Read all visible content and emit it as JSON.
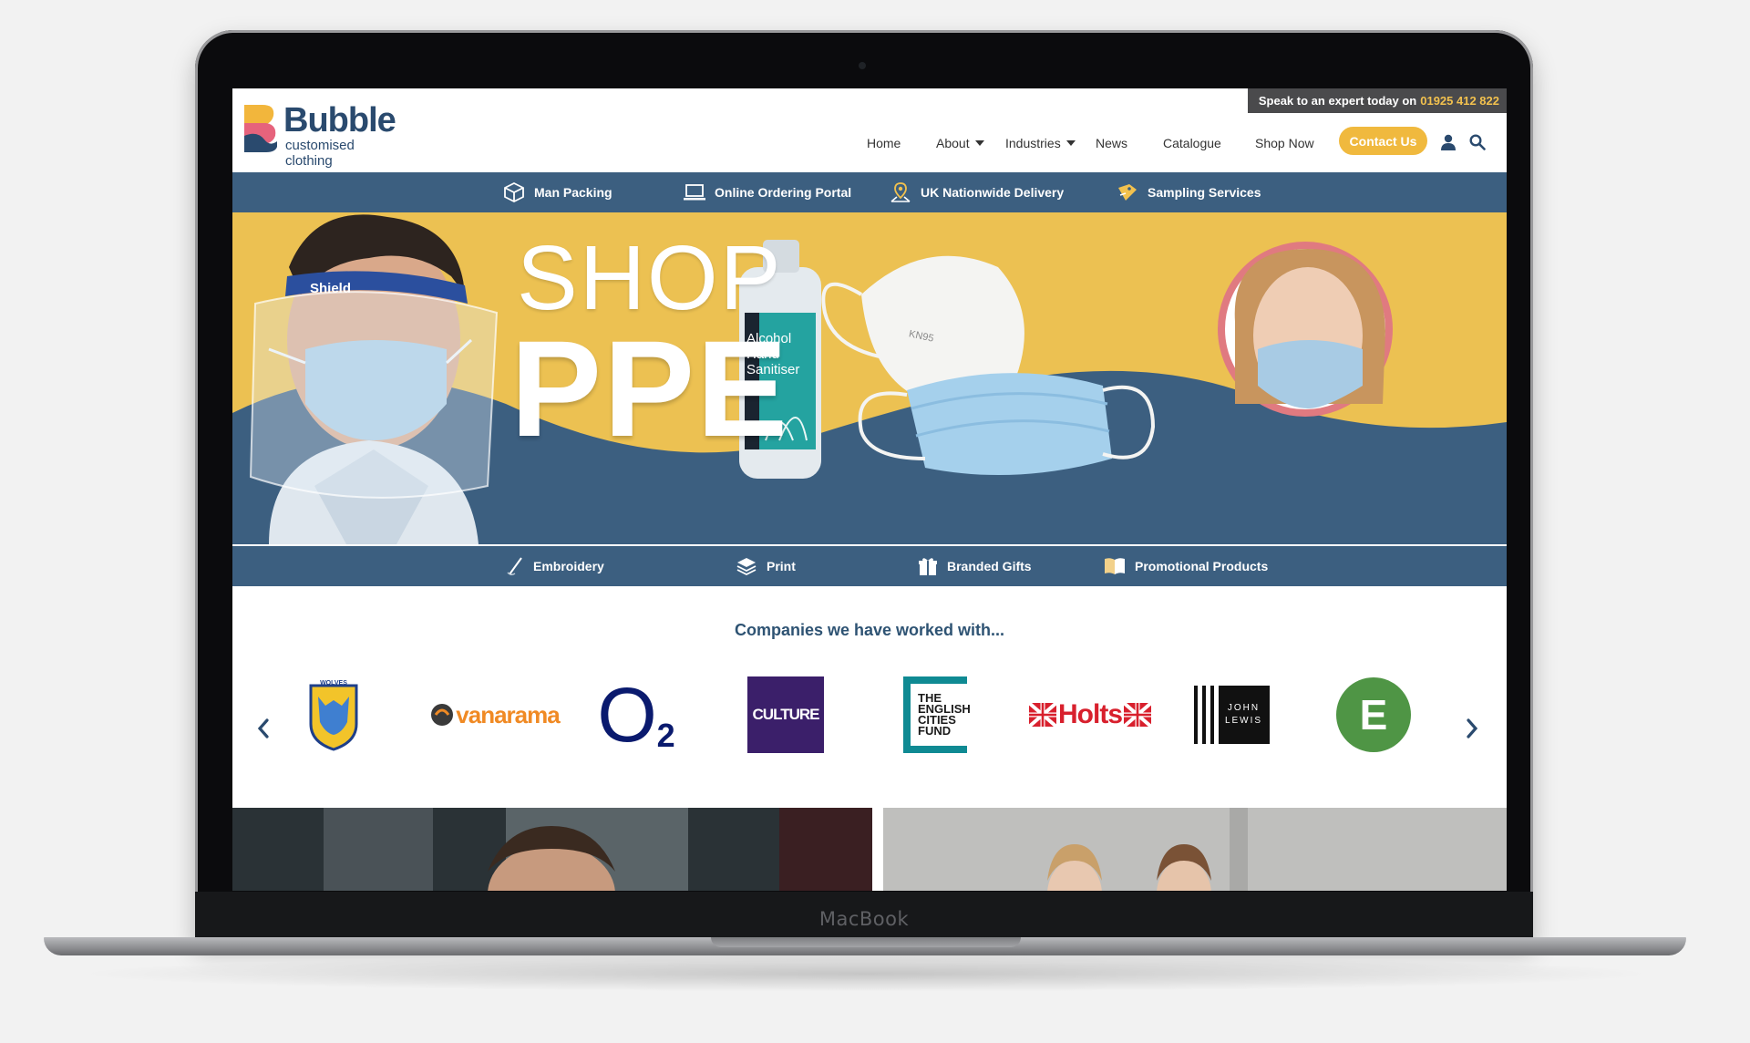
{
  "device": {
    "brand": "MacBook"
  },
  "header": {
    "logo": {
      "name": "Bubble",
      "tagline": "customised clothing"
    },
    "topbar": {
      "text": "Speak to an expert today on",
      "phone": "01925 412 822"
    },
    "nav": [
      {
        "label": "Home",
        "dropdown": false
      },
      {
        "label": "About",
        "dropdown": true
      },
      {
        "label": "Industries",
        "dropdown": true
      },
      {
        "label": "News",
        "dropdown": false
      },
      {
        "label": "Catalogue",
        "dropdown": false
      },
      {
        "label": "Shop Now",
        "dropdown": false
      }
    ],
    "contact_label": "Contact Us",
    "icons": [
      "user-icon",
      "search-icon"
    ]
  },
  "services_bar": [
    {
      "label": "Man Packing",
      "icon": "box-icon"
    },
    {
      "label": "Online Ordering Portal",
      "icon": "laptop-icon"
    },
    {
      "label": "UK Nationwide Delivery",
      "icon": "map-pin-icon"
    },
    {
      "label": "Sampling Services",
      "icon": "tag-icon"
    }
  ],
  "hero": {
    "headline_top": "SHOP",
    "headline_main": "PPE",
    "shield_text": "Shield",
    "bottle_text": [
      "Alcohol",
      "Hand",
      "Sanitiser"
    ],
    "mask_text": "KN95"
  },
  "products_bar": [
    {
      "label": "Embroidery",
      "icon": "needle-icon"
    },
    {
      "label": "Print",
      "icon": "layers-icon"
    },
    {
      "label": "Branded Gifts",
      "icon": "gift-icon"
    },
    {
      "label": "Promotional Products",
      "icon": "book-icon"
    }
  ],
  "companies": {
    "title": "Companies we have worked with...",
    "logos": [
      {
        "name": "Warrington Wolves",
        "text": "WOLVES"
      },
      {
        "name": "Vanarama",
        "text": "vanarama"
      },
      {
        "name": "O2",
        "text": "O"
      },
      {
        "name": "Warrington Culture",
        "text": "CULTURE"
      },
      {
        "name": "The English Cities Fund",
        "text": "THE ENGLISH CITIES FUND"
      },
      {
        "name": "Holts",
        "text": "Holts"
      },
      {
        "name": "John Lewis",
        "text": "JOHN LEWIS"
      },
      {
        "name": "L&E",
        "text": "E"
      }
    ]
  },
  "colors": {
    "navy": "#3c5f80",
    "accent": "#f0b93e",
    "hero_yellow": "#ecc152",
    "title": "#2e5373"
  }
}
